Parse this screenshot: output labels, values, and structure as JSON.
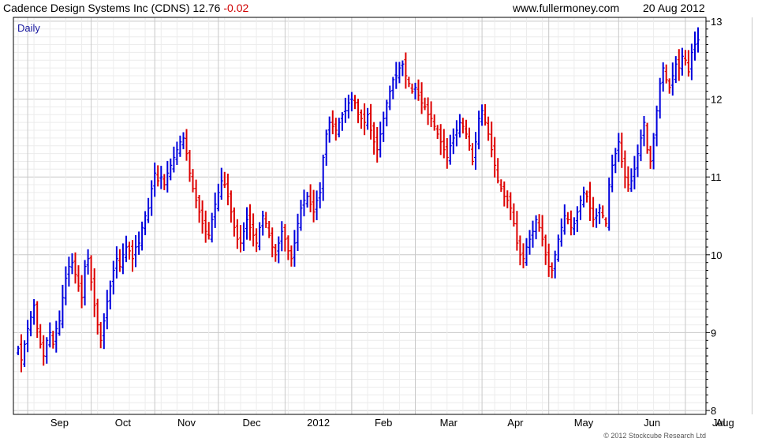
{
  "header": {
    "company": "Cadence Design Systems Inc (CDNS)",
    "price": "12.76",
    "change": "-0.02",
    "website": "www.fullermoney.com",
    "date": "20 Aug 2012"
  },
  "copyright": "© 2012 Stockcube Research Ltd",
  "colors": {
    "up": "#0000dd",
    "down": "#dd0000",
    "grid_major": "#c8c8c8",
    "grid_minor": "#ececec"
  },
  "chart_data": {
    "type": "ohlc",
    "period_label": "Daily",
    "y_axis": {
      "side": "right",
      "ylim": [
        7.95,
        13.05
      ],
      "ticks": [
        8,
        9,
        10,
        11,
        12,
        13
      ]
    },
    "x_axis": {
      "labels": [
        "Sep",
        "Oct",
        "Nov",
        "Dec",
        "2012",
        "Feb",
        "Mar",
        "Apr",
        "May",
        "Jun",
        "Jul",
        "Aug"
      ],
      "label_start_index": [
        3,
        23,
        43,
        63,
        84,
        105,
        125,
        146,
        167,
        189,
        210,
        231
      ]
    },
    "grid": true,
    "legend": "none",
    "series": [
      {
        "name": "CDNS",
        "description": "daily closing prices, approx. 21 Aug 2011 - 20 Aug 2012",
        "close": [
          8.8,
          8.65,
          8.85,
          9.05,
          9.2,
          9.35,
          9.05,
          8.85,
          8.7,
          8.9,
          9.0,
          8.85,
          9.05,
          9.15,
          9.45,
          9.7,
          9.85,
          9.9,
          9.75,
          9.6,
          9.45,
          9.85,
          9.95,
          9.65,
          9.35,
          9.1,
          8.9,
          9.15,
          9.4,
          9.6,
          9.8,
          9.95,
          9.85,
          10.0,
          10.1,
          10.05,
          9.95,
          10.1,
          10.15,
          10.35,
          10.5,
          10.6,
          10.85,
          11.05,
          10.95,
          11.0,
          10.9,
          11.05,
          11.15,
          11.25,
          11.35,
          11.45,
          11.5,
          11.3,
          11.05,
          10.85,
          10.7,
          10.55,
          10.4,
          10.3,
          10.25,
          10.45,
          10.65,
          10.8,
          10.95,
          10.9,
          10.75,
          10.55,
          10.35,
          10.2,
          10.15,
          10.3,
          10.45,
          10.35,
          10.25,
          10.15,
          10.35,
          10.5,
          10.4,
          10.25,
          10.1,
          10.0,
          10.15,
          10.3,
          10.2,
          10.05,
          9.95,
          10.15,
          10.4,
          10.6,
          10.7,
          10.75,
          10.65,
          10.55,
          10.7,
          10.8,
          11.25,
          11.55,
          11.7,
          11.65,
          11.6,
          11.7,
          11.8,
          11.85,
          11.95,
          12.0,
          11.95,
          11.8,
          11.75,
          11.7,
          11.8,
          11.6,
          11.45,
          11.35,
          11.55,
          11.75,
          11.95,
          12.1,
          12.25,
          12.3,
          12.4,
          12.45,
          12.3,
          12.2,
          12.1,
          12.15,
          12.05,
          11.95,
          11.9,
          11.8,
          11.75,
          11.65,
          11.55,
          11.45,
          11.35,
          11.25,
          11.4,
          11.5,
          11.6,
          11.7,
          11.65,
          11.55,
          11.4,
          11.2,
          11.45,
          11.75,
          11.85,
          11.7,
          11.55,
          11.35,
          11.15,
          10.95,
          10.85,
          10.75,
          10.7,
          10.6,
          10.4,
          10.15,
          10.0,
          9.95,
          10.1,
          10.2,
          10.3,
          10.45,
          10.35,
          10.2,
          10.0,
          9.85,
          9.8,
          10.0,
          10.2,
          10.35,
          10.5,
          10.45,
          10.35,
          10.4,
          10.55,
          10.7,
          10.8,
          10.75,
          10.6,
          10.45,
          10.5,
          10.6,
          10.5,
          10.4,
          10.9,
          11.15,
          11.3,
          11.45,
          11.2,
          11.0,
          10.9,
          10.95,
          11.1,
          11.3,
          11.5,
          11.7,
          11.35,
          11.2,
          11.5,
          11.85,
          12.2,
          12.4,
          12.25,
          12.15,
          12.3,
          12.45,
          12.4,
          12.55,
          12.5,
          12.35,
          12.6,
          12.7,
          12.76
        ]
      }
    ]
  }
}
